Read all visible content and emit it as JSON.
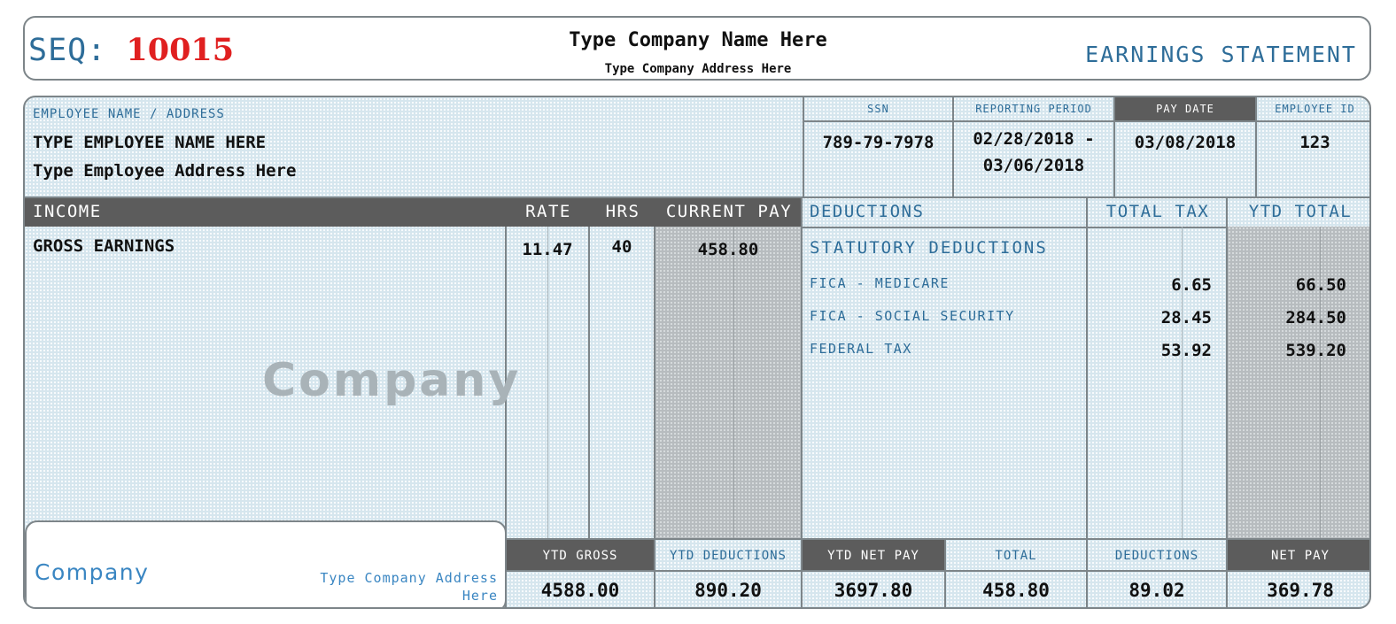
{
  "header": {
    "seq_label": "SEQ:",
    "seq_number": "10015",
    "company_name": "Type Company Name Here",
    "company_address": "Type Company Address Here",
    "doc_title": "EARNINGS STATEMENT"
  },
  "employee": {
    "section_label": "EMPLOYEE NAME / ADDRESS",
    "name": "TYPE EMPLOYEE NAME HERE",
    "address": "Type Employee Address Here"
  },
  "info": {
    "ssn_label": "SSN",
    "ssn": "789-79-7978",
    "period_label": "REPORTING PERIOD",
    "period_start": "02/28/2018 -",
    "period_end": "03/06/2018",
    "paydate_label": "PAY DATE",
    "paydate": "03/08/2018",
    "empid_label": "EMPLOYEE ID",
    "empid": "123"
  },
  "income": {
    "headers": {
      "income": "INCOME",
      "rate": "RATE",
      "hrs": "HRS",
      "current_pay": "CURRENT PAY"
    },
    "rows": [
      {
        "label": "GROSS EARNINGS",
        "rate": "11.47",
        "hrs": "40",
        "current_pay": "458.80"
      }
    ],
    "watermark": "Company"
  },
  "deductions": {
    "headers": {
      "deductions": "DEDUCTIONS",
      "total_tax": "TOTAL TAX",
      "ytd_total": "YTD TOTAL"
    },
    "section_title": "STATUTORY DEDUCTIONS",
    "rows": [
      {
        "label": "FICA - MEDICARE",
        "total_tax": "6.65",
        "ytd_total": "66.50"
      },
      {
        "label": "FICA - SOCIAL SECURITY",
        "total_tax": "28.45",
        "ytd_total": "284.50"
      },
      {
        "label": "FEDERAL TAX",
        "total_tax": "53.92",
        "ytd_total": "539.20"
      }
    ]
  },
  "footer_company": {
    "name": "Company",
    "address_line1": "Type Company Address",
    "address_line2": "Here"
  },
  "totals": {
    "ytd_gross_label": "YTD GROSS",
    "ytd_gross": "4588.00",
    "ytd_deductions_label": "YTD DEDUCTIONS",
    "ytd_deductions": "890.20",
    "ytd_net_label": "YTD NET PAY",
    "ytd_net": "3697.80",
    "total_label": "TOTAL",
    "total": "458.80",
    "deductions_label": "DEDUCTIONS",
    "deductions": "89.02",
    "net_label": "NET PAY",
    "net": "369.78"
  }
}
